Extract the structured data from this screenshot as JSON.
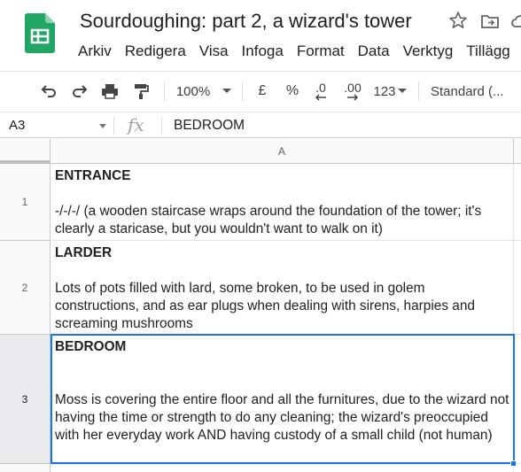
{
  "app": {
    "document_title": "Sourdoughing: part 2, a wizard's tower"
  },
  "menu": {
    "items": [
      "Arkiv",
      "Redigera",
      "Visa",
      "Infoga",
      "Format",
      "Data",
      "Verktyg",
      "Tillägg"
    ]
  },
  "toolbar": {
    "zoom": "100%",
    "currency_label": "£",
    "percent_label": "%",
    "decrease_decimals_label": ".0",
    "increase_decimals_label": ".00",
    "more_formats_label": "123",
    "font_label": "Standard (..."
  },
  "formula_bar": {
    "name_box": "A3",
    "fx_label": "fx",
    "value": "BEDROOM"
  },
  "sheet": {
    "column_header": "A",
    "rows": [
      {
        "number": "1",
        "title": "ENTRANCE",
        "body": "-/-/-/ (a wooden staircase wraps around the foundation of the tower; it's clearly a staricase, but you wouldn't want to walk on it)"
      },
      {
        "number": "2",
        "title": "LARDER",
        "body": "Lots of pots filled with lard, some broken, to be used in golem constructions, and as ear plugs when dealing with sirens, harpies and screaming mushrooms"
      },
      {
        "number": "3",
        "title": "BEDROOM",
        "body": "Moss is covering the entire floor and all the furnitures, due to the wizard not having the time or strength to do any cleaning; the wizard's preoccupied with her everyday work AND having custody of a small child (not human)"
      }
    ]
  },
  "colors": {
    "sheets_green": "#0f9d58",
    "selection_blue": "#1a73e8"
  }
}
